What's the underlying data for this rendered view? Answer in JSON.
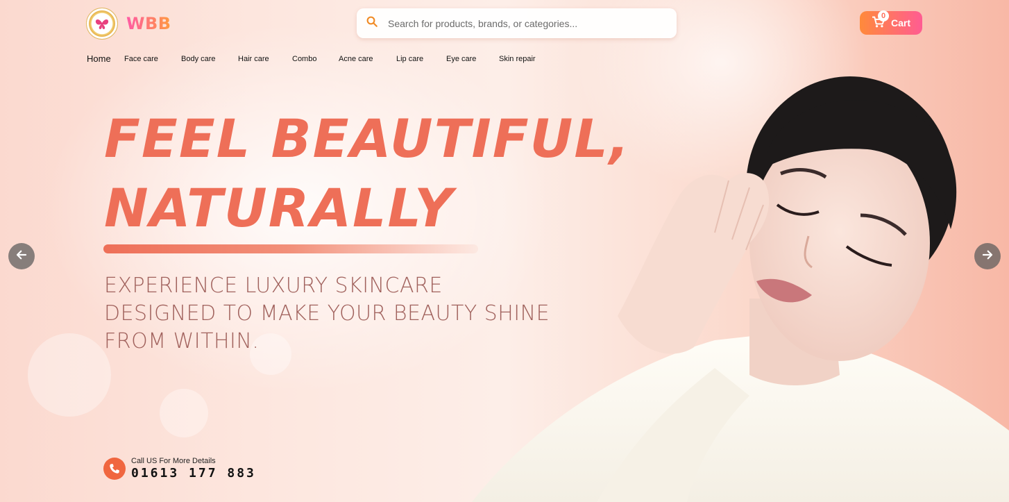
{
  "brand": {
    "name": "WBB",
    "logo_icon": "butterfly-icon"
  },
  "search": {
    "placeholder": "Search for products, brands, or categories...",
    "value": "",
    "icon": "search-icon"
  },
  "cart": {
    "label": "Cart",
    "count": "0",
    "icon": "cart-icon"
  },
  "nav": {
    "items": [
      {
        "label": "Home"
      },
      {
        "label": "Face care"
      },
      {
        "label": "Body care"
      },
      {
        "label": "Hair care"
      },
      {
        "label": "Combo"
      },
      {
        "label": "Acne care"
      },
      {
        "label": "Lip care"
      },
      {
        "label": "Eye care"
      },
      {
        "label": "Skin repair"
      }
    ]
  },
  "hero": {
    "headline_line1": "FEEL BEAUTIFUL,",
    "headline_line2": "NATURALLY",
    "subtext_line1": "EXPERIENCE LUXURY SKINCARE",
    "subtext_line2": "DESIGNED TO MAKE YOUR BEAUTY SHINE",
    "subtext_line3": "FROM WITHIN."
  },
  "carousel": {
    "prev_icon": "arrow-left-icon",
    "next_icon": "arrow-right-icon"
  },
  "contact": {
    "label": "Call US For More Details",
    "phone": "01613 177 883",
    "icon": "phone-icon"
  },
  "colors": {
    "headline": "#ee6f58",
    "accent_orange": "#ff8a3b",
    "accent_pink": "#ff5c92",
    "subtext": "#a0615c"
  }
}
